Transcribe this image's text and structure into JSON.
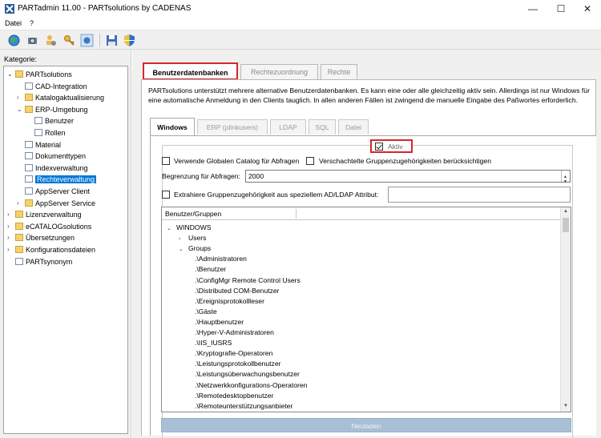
{
  "window": {
    "title": "PARTadmin 11.00 - PARTsolutions by CADENAS",
    "minimize_glyph": "—",
    "maximize_glyph": "☐",
    "close_glyph": "✕"
  },
  "menu": [
    "Datei",
    "?"
  ],
  "toolbar": {
    "icons": [
      "globe-icon",
      "catalog-gear-icon",
      "user-gear-icon",
      "key-icon",
      "network-gear-icon",
      "save-icon",
      "shield-icon"
    ]
  },
  "sidebar": {
    "label": "Kategorie:",
    "items": [
      {
        "label": "PARTsolutions",
        "level": 0,
        "expander": "⌄",
        "icon": "folder"
      },
      {
        "label": "CAD-Integration",
        "level": 1,
        "expander": "",
        "icon": "doc"
      },
      {
        "label": "Katalogaktualisierung",
        "level": 1,
        "expander": "›",
        "icon": "folder"
      },
      {
        "label": "ERP-Umgebung",
        "level": 1,
        "expander": "⌄",
        "icon": "folder"
      },
      {
        "label": "Benutzer",
        "level": 2,
        "expander": "",
        "icon": "doc"
      },
      {
        "label": "Rollen",
        "level": 2,
        "expander": "",
        "icon": "doc"
      },
      {
        "label": "Material",
        "level": 1,
        "expander": "",
        "icon": "doc"
      },
      {
        "label": "Dokumenttypen",
        "level": 1,
        "expander": "",
        "icon": "doc"
      },
      {
        "label": "Indexverwaltung",
        "level": 1,
        "expander": "",
        "icon": "doc"
      },
      {
        "label": "Rechteverwaltung",
        "level": 1,
        "expander": "",
        "icon": "doc",
        "selected": true
      },
      {
        "label": "AppServer Client",
        "level": 1,
        "expander": "",
        "icon": "doc"
      },
      {
        "label": "AppServer Service",
        "level": 1,
        "expander": "›",
        "icon": "folder"
      },
      {
        "label": "Lizenzverwaltung",
        "level": 0,
        "expander": "›",
        "icon": "folder"
      },
      {
        "label": "eCATALOGsolutions",
        "level": 0,
        "expander": "›",
        "icon": "folder"
      },
      {
        "label": "Übersetzungen",
        "level": 0,
        "expander": "›",
        "icon": "folder"
      },
      {
        "label": "Konfigurationsdateien",
        "level": 0,
        "expander": "›",
        "icon": "folder"
      },
      {
        "label": "PARTsynonym",
        "level": 0,
        "expander": "",
        "icon": "doc"
      }
    ]
  },
  "top_tabs": [
    {
      "label": "Benutzerdatenbanken",
      "active": true
    },
    {
      "label": "Rechtezuordnung",
      "active": false
    },
    {
      "label": "Rechte",
      "active": false
    }
  ],
  "description": "PARTsolutions unterstützt mehrere alternative Benutzerdatenbanken. Es kann eine oder alle gleichzeitig aktiv sein. Allerdings ist nur Windows für eine automatische Anmeldung in den Clients tauglich. In allen anderen Fällen ist zwingend die manuelle Eingabe des Paßwortes erforderlich.",
  "sub_tabs": [
    {
      "label": "Windows",
      "active": true
    },
    {
      "label": "ERP (plinkusers)",
      "active": false
    },
    {
      "label": "LDAP",
      "active": false
    },
    {
      "label": "SQL",
      "active": false
    },
    {
      "label": "Datei",
      "active": false
    }
  ],
  "windows_tab": {
    "aktiv_label": "Aktiv",
    "aktiv_checked": true,
    "global_catalog_label": "Verwende Globalen Catalog für Abfragen",
    "global_catalog_checked": false,
    "nested_groups_label": "Verschachtelte Gruppenzugehörigkeiten berücksichtigen",
    "nested_groups_checked": false,
    "limit_label": "Begrenzung für Abfragen:",
    "limit_value": "2000",
    "extra_group_label": "Extrahiere Gruppenzugehörigkeit aus speziellem AD/LDAP Attribut:",
    "extra_group_checked": false,
    "extra_group_value": "",
    "list_header": "Benutzer/Gruppen",
    "tree": [
      {
        "label": "WINDOWS",
        "indent": 0,
        "arrow": "⌄"
      },
      {
        "label": "Users",
        "indent": 1,
        "arrow": "›"
      },
      {
        "label": "Groups",
        "indent": 1,
        "arrow": "⌄"
      },
      {
        "label": ".\\Administratoren",
        "indent": 2,
        "arrow": ""
      },
      {
        "label": ".\\Benutzer",
        "indent": 2,
        "arrow": ""
      },
      {
        "label": ".\\ConfigMgr Remote Control Users",
        "indent": 2,
        "arrow": ""
      },
      {
        "label": ".\\Distributed COM-Benutzer",
        "indent": 2,
        "arrow": ""
      },
      {
        "label": ".\\Ereignisprotokollleser",
        "indent": 2,
        "arrow": ""
      },
      {
        "label": ".\\Gäste",
        "indent": 2,
        "arrow": ""
      },
      {
        "label": ".\\Hauptbenutzer",
        "indent": 2,
        "arrow": ""
      },
      {
        "label": ".\\Hyper-V-Administratoren",
        "indent": 2,
        "arrow": ""
      },
      {
        "label": ".\\IIS_IUSRS",
        "indent": 2,
        "arrow": ""
      },
      {
        "label": ".\\Kryptografie-Operatoren",
        "indent": 2,
        "arrow": ""
      },
      {
        "label": ".\\Leistungsprotokollbenutzer",
        "indent": 2,
        "arrow": ""
      },
      {
        "label": ".\\Leistungsüberwachungsbenutzer",
        "indent": 2,
        "arrow": ""
      },
      {
        "label": ".\\Netzwerkkonfigurations-Operatoren",
        "indent": 2,
        "arrow": ""
      },
      {
        "label": ".\\Remotedesktopbenutzer",
        "indent": 2,
        "arrow": ""
      },
      {
        "label": ".\\Remoteunterstützungsanbieter",
        "indent": 2,
        "arrow": ""
      }
    ],
    "reload_label": "Neuladen"
  },
  "colors": {
    "highlight_border": "#d9252a",
    "selection": "#0078d7",
    "disabled_button": "#a8bfd6"
  }
}
